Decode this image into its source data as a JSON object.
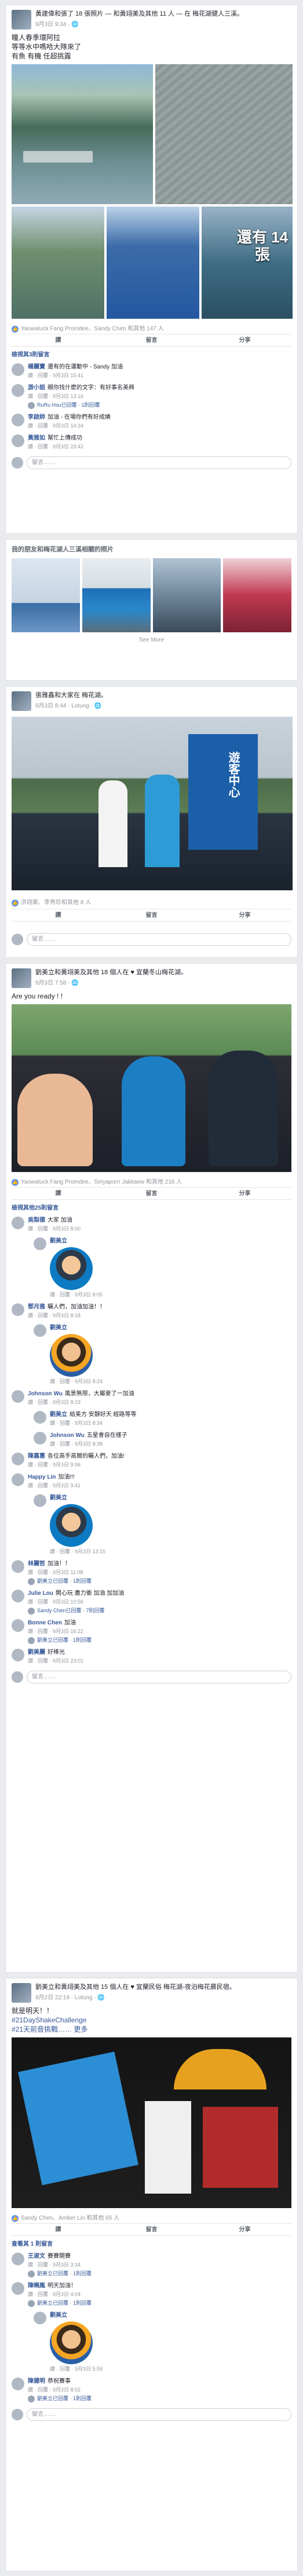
{
  "post1": {
    "header": "黃建偉和張了 18 張照片 — 和黃翊美及其他 11 人 — 在 梅花湖健人三溪。",
    "meta": "9月3日 9:34 · 🌐",
    "text": "瞳人春季環阿拉\n等等水中嗎哈大隊來了\n有魚 有機 任超挑露",
    "overlay": "還有 14\n張",
    "reactions": "Yaowaluck Fang Promdee、Sandy Chen 和其他 147 人",
    "actions": [
      "讚",
      "留言",
      "分享"
    ],
    "prev_comments": "檢視其3則留言",
    "comments": [
      {
        "name": "楊麗寶",
        "text": "還有的在運動中 - Sandy 加油",
        "meta": "讚 · 回覆 · 9月3日 15:41",
        "reply": false
      },
      {
        "name": "游小姐",
        "text": "親你找什麼的文字：有好事名美興",
        "meta": "讚 · 回覆 · 9月3日 13:16",
        "reply": false,
        "sub": "RuRu Hsu已回覆 · 1則回覆"
      },
      {
        "name": "李啟帥",
        "text": "加油 - 在場你們有好成績",
        "meta": "讚 · 回覆 · 9月3日 14:34",
        "reply": false
      },
      {
        "name": "黃雅如",
        "text": "幫忙上傳成功",
        "meta": "讚 · 回覆 · 9月3日 23:42",
        "reply": false
      }
    ],
    "write": "留言……"
  },
  "ads": {
    "title": "我的朋友和梅花湖人三溪相關的照片",
    "see_more": "See More"
  },
  "post2": {
    "header": "張雅鑫和大家在 梅花湖。",
    "meta": "9月3日 8:44 · Lotung · 🌐",
    "sign": "遊客中心",
    "reactions": "洪翊豪、李秀珍和其他 8 人",
    "actions": [
      "讚",
      "留言",
      "分享"
    ],
    "write": "留言……"
  },
  "post3": {
    "header": "劉美立和黃翊美及其他 18 個人在 ♥ 宜蘭冬山梅花湖。",
    "meta": "9月3日 7:58 · 🌐",
    "text": "Are you ready ! !",
    "reactions": "Yaowaluck Fang Promdee、Siriyaporn Jakkaew 和其他 216 人",
    "actions": [
      "讚",
      "留言",
      "分享"
    ],
    "prev_comments": "檢視其他25則留言",
    "comments": [
      {
        "name": "吳梨德",
        "text": "大家 加油",
        "meta": "讚 · 回覆 · 9月3日 8:00",
        "reply": false
      },
      {
        "name": "劉美立",
        "text": "",
        "meta": "讚 · 回覆 · 9月3日 8:05",
        "reply": true,
        "sticker": "st1"
      },
      {
        "name": "鄧月雅",
        "text": "曬人們，加油加油！！",
        "meta": "讚 · 回覆 · 9月3日 8:18",
        "reply": false
      },
      {
        "name": "劉美立",
        "text": "",
        "meta": "讚 · 回覆 · 9月3日 8:24",
        "reply": true,
        "sticker": "st2"
      },
      {
        "name": "Johnson Wu",
        "text": "風景無限，大屬麥了一加油",
        "meta": "讚 · 回覆 · 9月3日 8:23",
        "reply": false
      },
      {
        "name": "劉美立",
        "text": "給美方 安靜好天 經路等等",
        "meta": "讚 · 回覆 · 9月3日 8:34",
        "reply": true
      },
      {
        "name": "Johnson Wu",
        "text": "五星會自在樣子",
        "meta": "讚 · 回覆 · 9月3日 8:38",
        "reply": true
      },
      {
        "name": "陳嘉惠",
        "text": "各位高手高爾的曬人們，加油!",
        "meta": "讚 · 回覆 · 9月3日 9:06",
        "reply": false
      },
      {
        "name": "Happy Lin",
        "text": "加油!!!",
        "meta": "讚 · 回覆 · 9月3日 9:41",
        "reply": false
      },
      {
        "name": "劉美立",
        "text": "",
        "meta": "讚 · 回覆 · 9月3日 13:15",
        "reply": true,
        "sticker": "st1"
      },
      {
        "name": "林麗哲",
        "text": "加油！！",
        "meta": "讚 · 回覆 · 9月3日 11:08",
        "reply": false,
        "sub": "劉美立已回覆 · 1則回覆"
      },
      {
        "name": "Julie Lou",
        "text": "開心玩 盡力衝 加油 加加油",
        "meta": "讚 · 回覆 · 9月3日 10:56",
        "reply": false,
        "sub": "Sandy Chen已回覆 · 7則回覆"
      },
      {
        "name": "Bonne Chen",
        "text": "加油",
        "meta": "讚 · 回覆 · 9月3日 16:22",
        "reply": false,
        "sub": "劉美立已回覆 · 1則回覆"
      },
      {
        "name": "劉美麗",
        "text": "好棒光",
        "meta": "讚 · 回覆 · 9月3日 23:01",
        "reply": false
      }
    ],
    "write": "留言……"
  },
  "post4": {
    "header": "劉美立和黃翊美及其他 15 個人在 ♥ 宜蘭民俗 梅花湖-夜泊梅花晨民宿。",
    "meta": "9月2日 22:19 · Lotung · 🌐",
    "text": "就是明天！！",
    "tags": [
      "#21DayShakeChallenge",
      "#21天前音挑戰"
    ],
    "more": "…… 更多",
    "reactions": "Sandy Chen、Amber Lin 和其他 65 人",
    "actions": [
      "讚",
      "留言",
      "分享"
    ],
    "prev_comments": "查看其 1 則留言",
    "comments": [
      {
        "name": "王淑文",
        "text": "賽賽開賽",
        "meta": "讚 · 回覆 · 9月3日 3:34",
        "reply": false,
        "sub": "劉美立已回覆 · 1則回覆"
      },
      {
        "name": "陳曉嵐",
        "text": "明天加油！",
        "meta": "讚 · 回覆 · 9月3日 4:04",
        "reply": false,
        "sub": "劉美立已回覆 · 1則回覆"
      },
      {
        "name": "劉美立",
        "text": "",
        "meta": "讚 · 回覆 · 9月3日 5:59",
        "reply": true,
        "sticker": "st2"
      },
      {
        "name": "陳健明",
        "text": "恭祝賽事",
        "meta": "讚 · 回覆 · 9月3日 8:02",
        "reply": false,
        "sub": "劉美立已回覆 · 1則回覆"
      }
    ],
    "write": "留言……"
  }
}
